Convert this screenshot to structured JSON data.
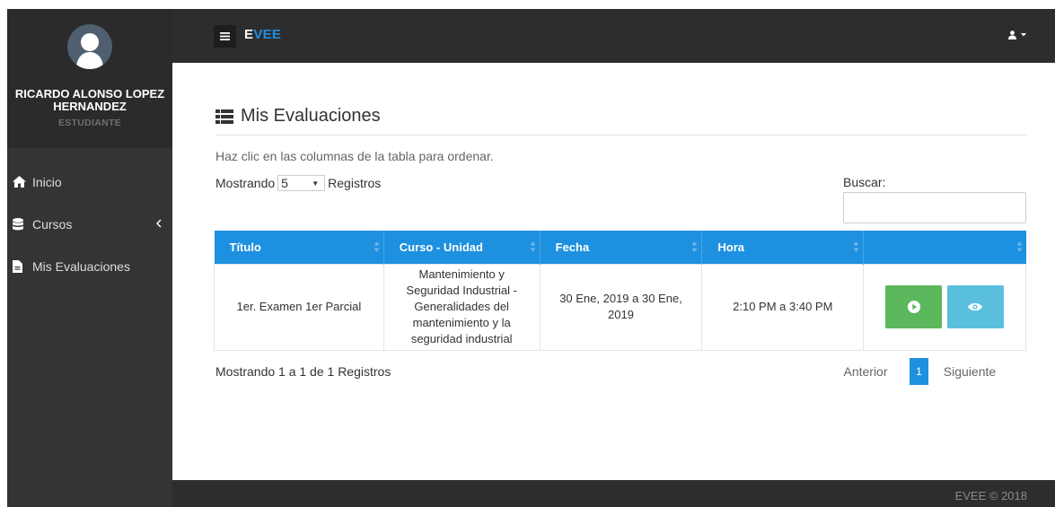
{
  "sidebar": {
    "user_name": "RICARDO ALONSO LOPEZ HERNANDEZ",
    "user_role": "ESTUDIANTE",
    "items": [
      {
        "label": "Inicio",
        "icon": "home-icon"
      },
      {
        "label": "Cursos",
        "icon": "database-icon",
        "has_submenu": true
      },
      {
        "label": "Mis Evaluaciones",
        "icon": "file-icon"
      }
    ]
  },
  "topbar": {
    "brand_part1": "E",
    "brand_part2": "VEE",
    "brand_color": "#1e90e0",
    "user_menu_icon": "user-icon"
  },
  "page": {
    "title": "Mis Evaluaciones",
    "title_icon": "list-icon",
    "hint": "Haz clic en las columnas de la tabla para ordenar.",
    "length_prefix": "Mostrando",
    "length_value": "5",
    "length_suffix": "Registros",
    "search_label": "Buscar:",
    "search_value": ""
  },
  "table": {
    "headers": [
      "Título",
      "Curso - Unidad",
      "Fecha",
      "Hora",
      ""
    ],
    "header_color": "#1e90e0",
    "rows": [
      {
        "titulo": "1er. Examen 1er Parcial",
        "curso_unidad": "Mantenimiento y Seguridad Industrial - Generalidades del mantenimiento y la seguridad industrial",
        "fecha": "30 Ene, 2019 a 30 Ene, 2019",
        "hora": "2:10 PM a 3:40 PM",
        "actions": [
          {
            "icon": "play-circle-icon",
            "color": "#5cb85c"
          },
          {
            "icon": "eye-icon",
            "color": "#5bc0de"
          }
        ]
      }
    ]
  },
  "pagination": {
    "info": "Mostrando 1 a 1 de 1 Registros",
    "previous": "Anterior",
    "current": "1",
    "next": "Siguiente"
  },
  "footer": {
    "text": "EVEE © 2018"
  }
}
